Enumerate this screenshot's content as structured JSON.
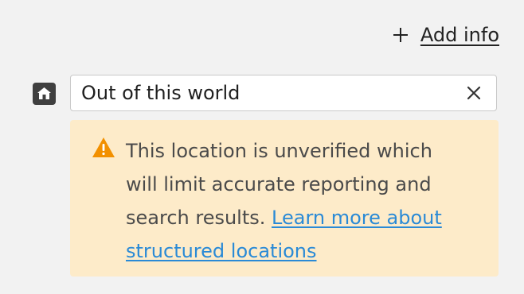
{
  "actions": {
    "add_info_label": "Add info"
  },
  "location": {
    "value": "Out of this world",
    "icon": "home-icon",
    "clear_icon": "close-icon"
  },
  "warning": {
    "icon": "warning-triangle-icon",
    "message": "This location is unverified which will limit accurate reporting and search results.",
    "link_text": "Learn more about structured locations",
    "icon_color": "#f29000",
    "background": "#fdebc9",
    "link_color": "#2a8ad6"
  }
}
